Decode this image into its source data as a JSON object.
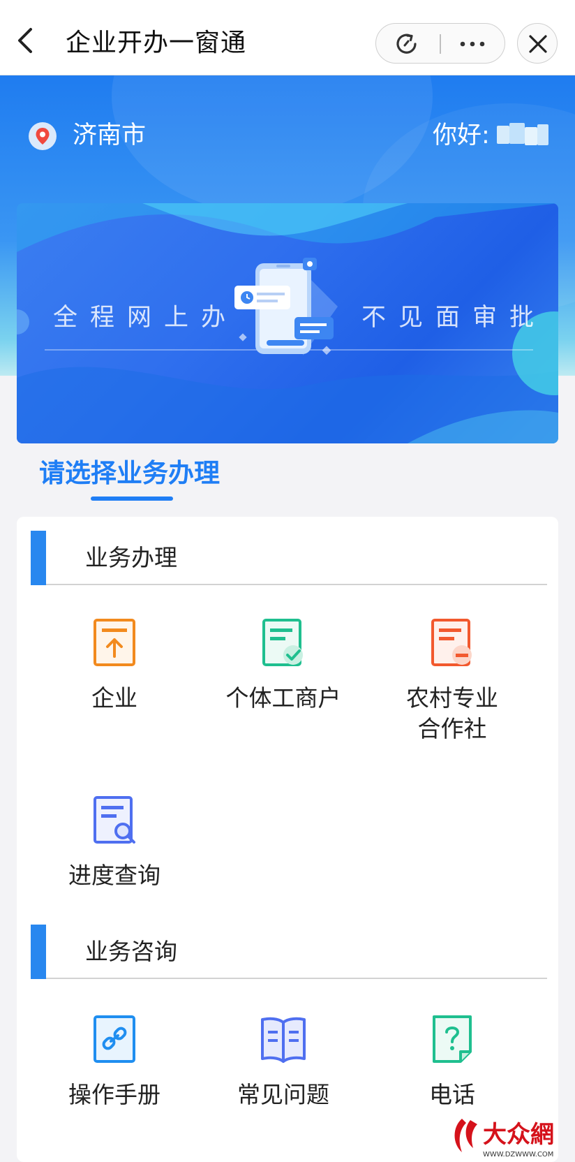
{
  "header": {
    "title": "企业开办一窗通",
    "back_icon": "chevron-left-icon",
    "refresh_icon": "refresh-icon",
    "more_icon": "more-icon",
    "close_icon": "close-icon"
  },
  "location": {
    "city": "济南市",
    "icon": "map-pin-icon"
  },
  "greeting": {
    "label": "你好:",
    "user_name_blurred": true
  },
  "banner": {
    "left_text": "全程网上办",
    "right_text": "不见面审批"
  },
  "section": {
    "heading": "请选择业务办理"
  },
  "groups": [
    {
      "title": "业务办理",
      "items": [
        {
          "label": "企业",
          "icon": "upload-document-icon",
          "color": "#f28a1e"
        },
        {
          "label": "个体工商户",
          "icon": "approved-document-icon",
          "color": "#1fbf8f"
        },
        {
          "label": "农村专业\n合作社",
          "icon": "document-minus-icon",
          "color": "#f2592e"
        },
        {
          "label": "进度查询",
          "icon": "document-search-icon",
          "color": "#4f6ff0"
        }
      ]
    },
    {
      "title": "业务咨询",
      "items": [
        {
          "label": "操作手册",
          "icon": "link-document-icon",
          "color": "#1f8ef0"
        },
        {
          "label": "常见问题",
          "icon": "open-book-icon",
          "color": "#4f6ff0"
        },
        {
          "label": "电话",
          "icon": "question-document-icon",
          "color": "#1fbf8f"
        }
      ]
    }
  ],
  "colors": {
    "accent": "#1f7ef5",
    "group_bar": "#2887ef"
  },
  "watermark": {
    "text": "大众網",
    "url_text": "WWW.DZWWW.COM"
  }
}
